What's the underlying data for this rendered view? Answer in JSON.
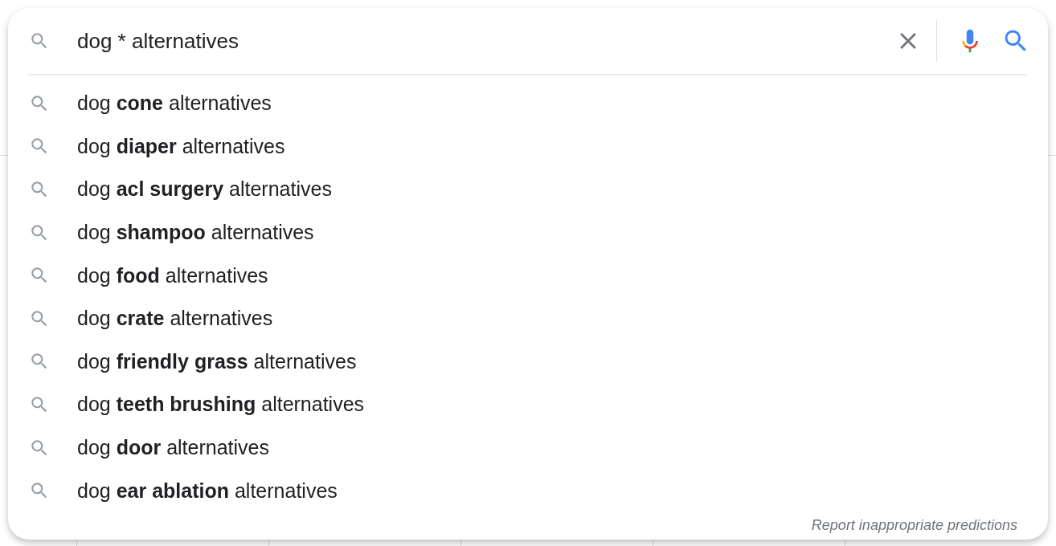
{
  "search": {
    "value": "dog * alternatives"
  },
  "suggestions": [
    {
      "text": "dog **cone** alternatives"
    },
    {
      "text": "dog **diaper** alternatives"
    },
    {
      "text": "dog **acl surgery** alternatives"
    },
    {
      "text": "dog **shampoo** alternatives"
    },
    {
      "text": "dog **food** alternatives"
    },
    {
      "text": "dog **crate** alternatives"
    },
    {
      "text": "dog **friendly grass** alternatives"
    },
    {
      "text": "dog **teeth brushing** alternatives"
    },
    {
      "text": "dog **door** alternatives"
    },
    {
      "text": "dog **ear ablation** alternatives"
    }
  ],
  "footer_link": "Report inappropriate predictions"
}
